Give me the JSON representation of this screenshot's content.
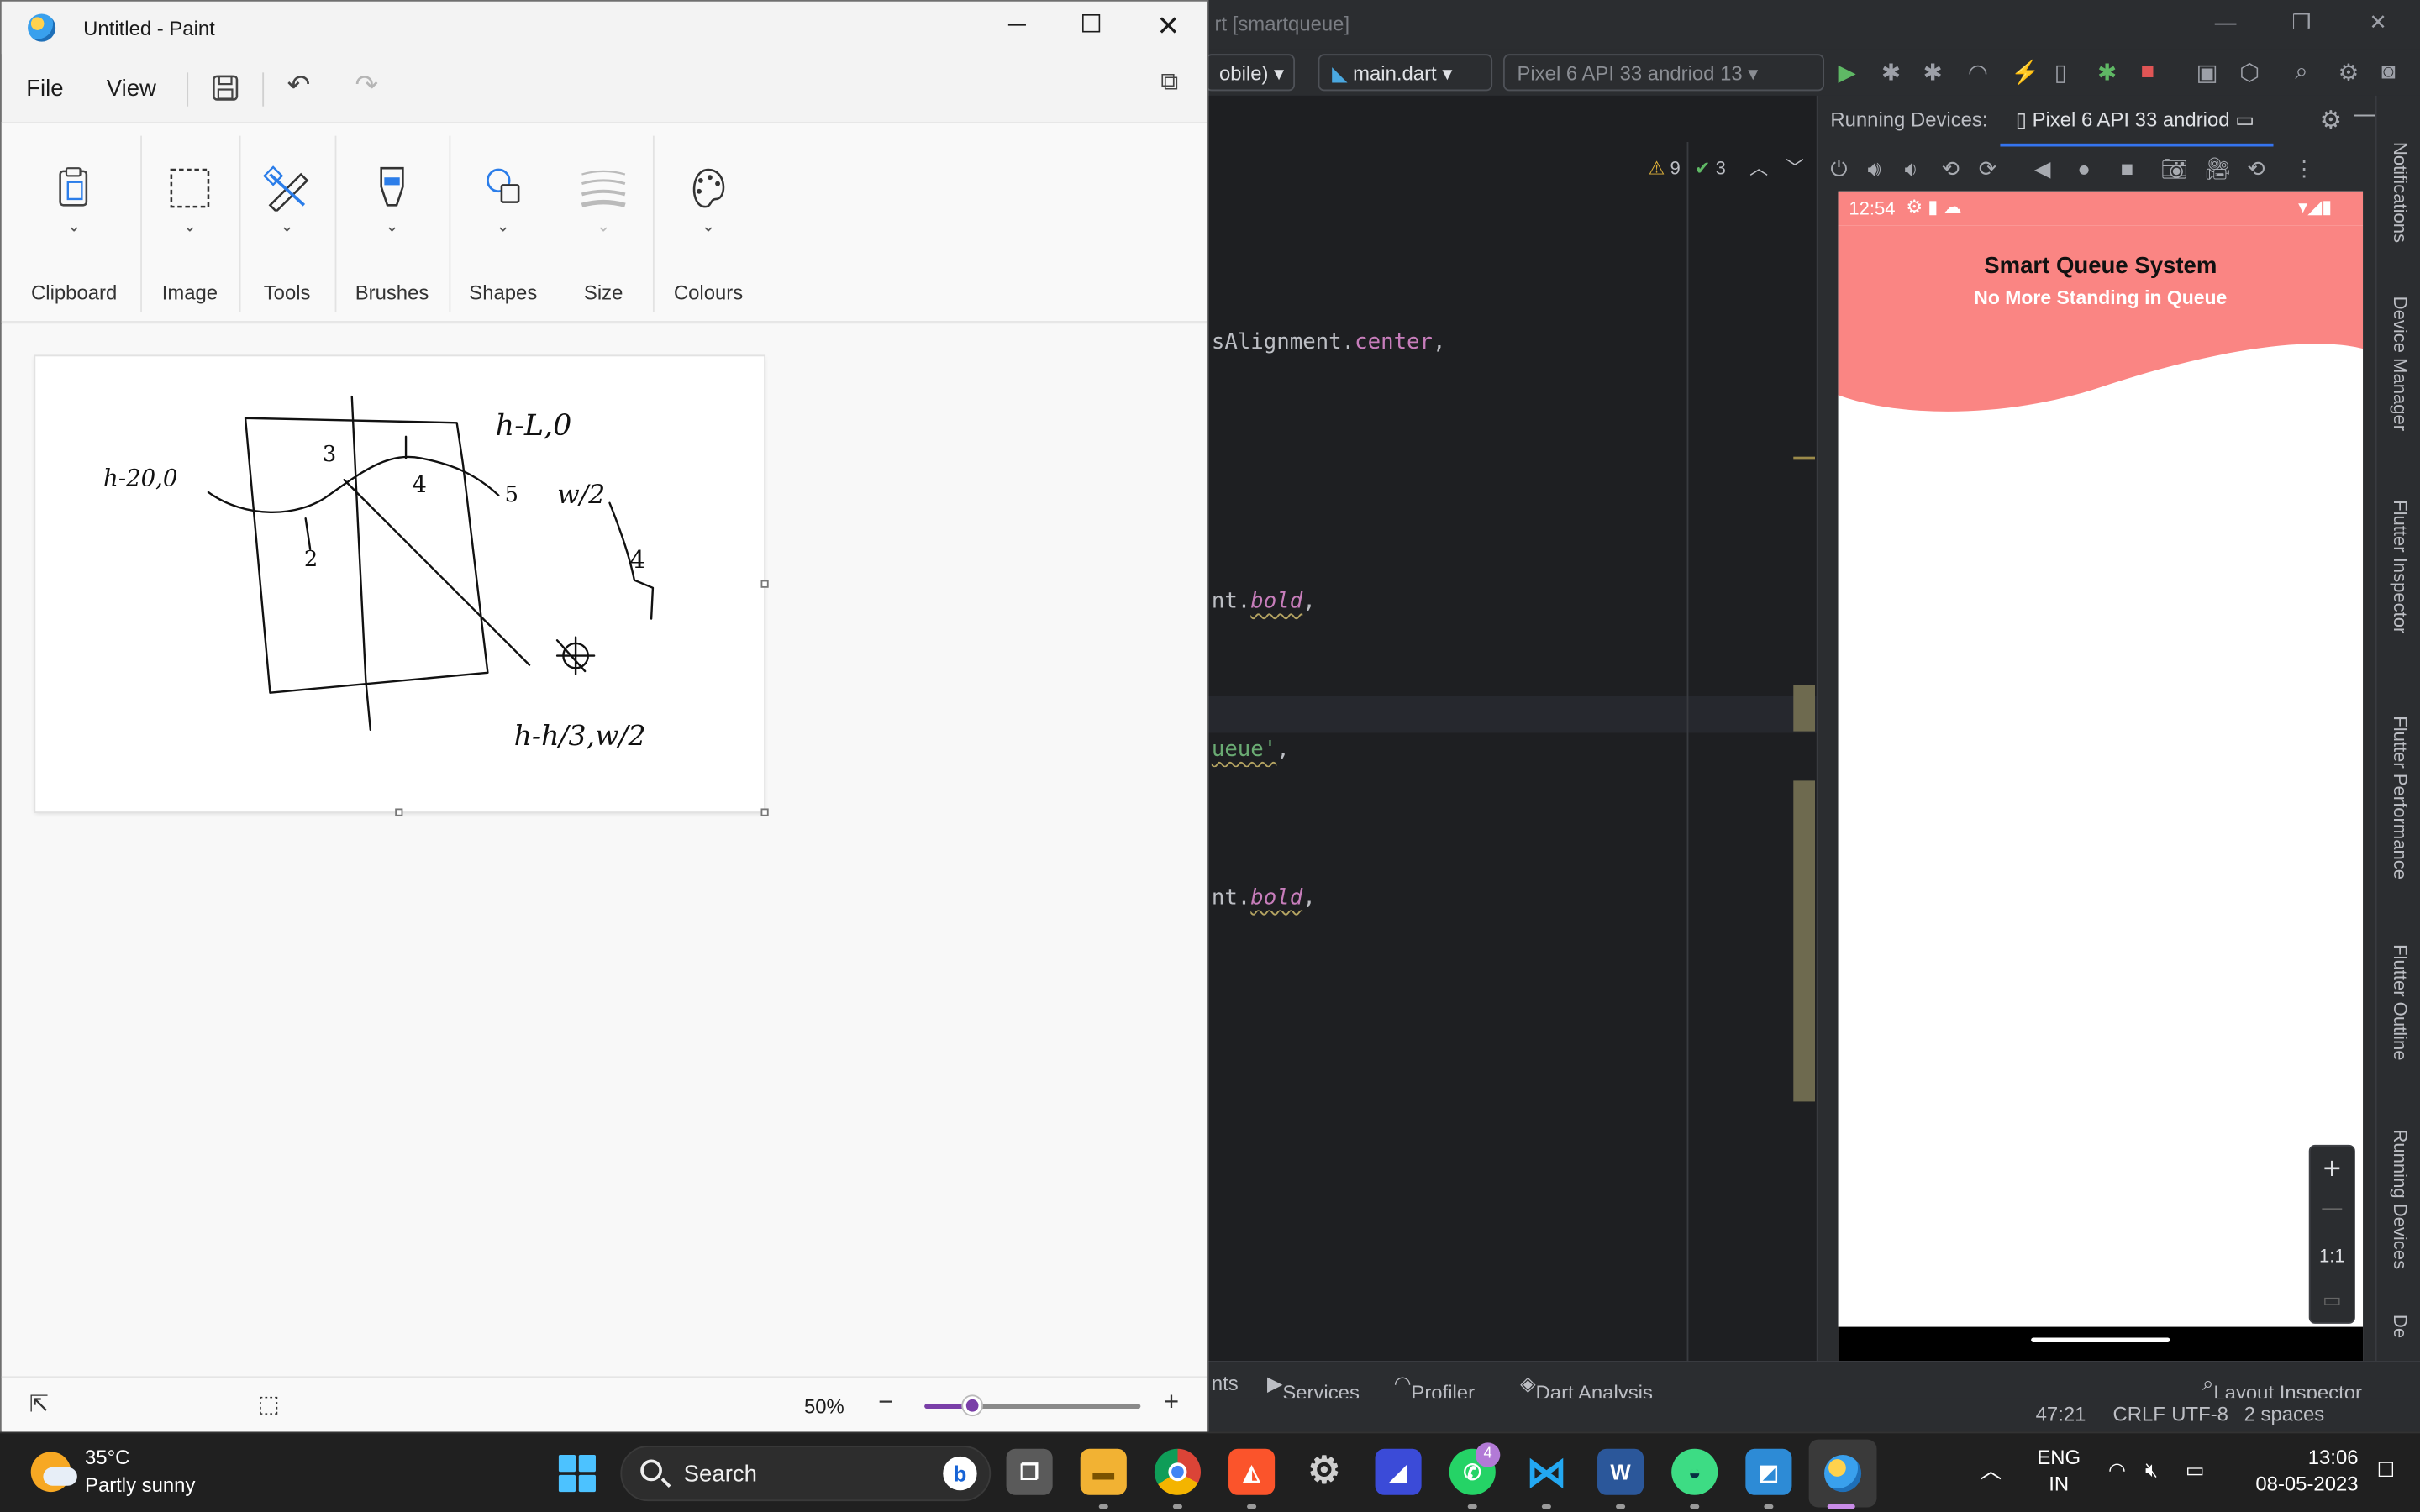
{
  "ide": {
    "title": "rt [smartqueue]",
    "device_combo": "obile)",
    "file_combo": "main.dart",
    "emulator_combo": "Pixel 6 API 33 andriod 13",
    "warnings": "9",
    "checks": "3",
    "code": {
      "line1_a": "sAlignment.",
      "line1_b": "center",
      "line1_c": ",",
      "line2_a": "nt.",
      "line2_b": "bold",
      "line2_c": ",",
      "line3_a": "ueue'",
      "line3_b": ",",
      "line4_a": "nt.",
      "line4_b": "bold",
      "line4_c": ","
    },
    "running_devices_label": "Running Devices:",
    "running_devices_tab": "Pixel 6 API 33 andriod",
    "right_tabs": [
      "Notifications",
      "Device Manager",
      "Flutter Inspector",
      "Flutter Performance",
      "Flutter Outline",
      "Running Devices",
      "De"
    ],
    "bottom_tabs": [
      "nts",
      "Services",
      "Profiler",
      "Dart Analysis",
      "Layout Inspector"
    ],
    "status": {
      "position": "47:21",
      "line_sep": "CRLF",
      "encoding": "UTF-8",
      "indent": "2 spaces"
    }
  },
  "phone": {
    "time": "12:54",
    "app_title": "Smart Queue System",
    "app_subtitle": "No More Standing in Queue",
    "header_color": "#fa8583",
    "zoom_plus": "+",
    "zoom_minus": "—",
    "zoom_ratio": "1:1"
  },
  "paint": {
    "window_title": "Untitled - Paint",
    "menu": [
      "File",
      "View"
    ],
    "groups": [
      "Clipboard",
      "Image",
      "Tools",
      "Brushes",
      "Shapes",
      "Size",
      "Colours"
    ],
    "zoom": "50%",
    "zoom_fraction": 0.22,
    "sketch_labels": {
      "left": "h-20,0",
      "top_right": "h-L,0",
      "mid_right": "w/2",
      "bottom": "h-h/3,w/2",
      "n3": "3",
      "n4": "4",
      "n5": "5",
      "n2": "2",
      "n4b": "4"
    }
  },
  "taskbar": {
    "weather_temp": "35°C",
    "weather_text": "Partly sunny",
    "search_label": "Search",
    "whatsapp_badge": "4",
    "lang_1": "ENG",
    "lang_2": "IN",
    "time": "13:06",
    "date": "08-05-2023"
  }
}
